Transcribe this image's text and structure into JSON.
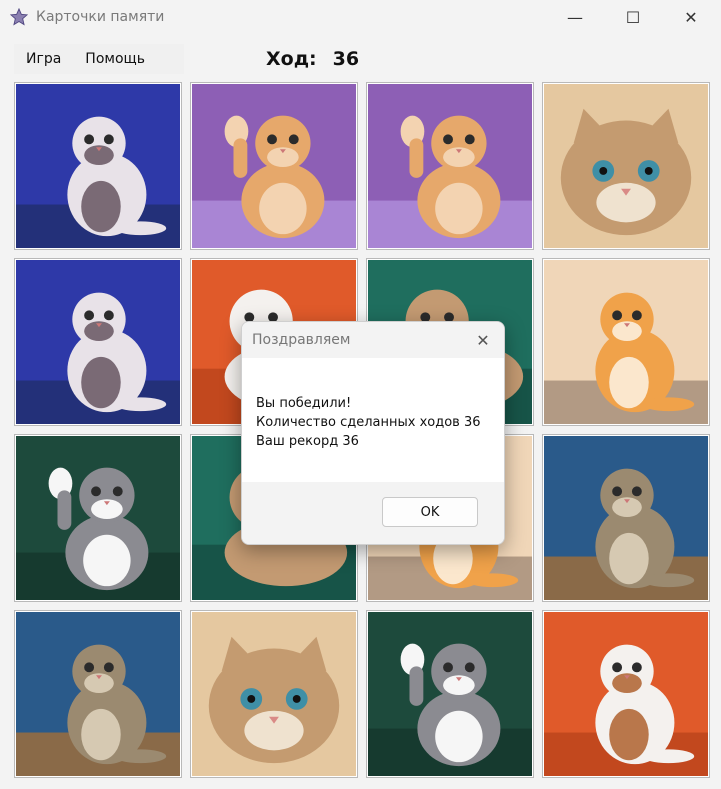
{
  "window": {
    "title": "Карточки памяти",
    "icon": "star-icon",
    "controls": {
      "minimize": "—",
      "maximize": "☐",
      "close": "✕"
    }
  },
  "menu": {
    "game": "Игра",
    "help": "Помощь"
  },
  "counter": {
    "label": "Ход:",
    "value": "36"
  },
  "cards": [
    {
      "bg": "#2e39a8",
      "floor": "#233079",
      "cat": "#e8e2e8",
      "patch": "#7a6a75",
      "pose": "sit"
    },
    {
      "bg": "#8d5fb5",
      "floor": "#a985d4",
      "cat": "#e6a86b",
      "patch": "#f3d3b1",
      "pose": "paw"
    },
    {
      "bg": "#8d5fb5",
      "floor": "#a985d4",
      "cat": "#e6a86b",
      "patch": "#f3d3b1",
      "pose": "paw"
    },
    {
      "bg": "#e5c8a0",
      "floor": "#d3b08a",
      "cat": "#c49b70",
      "patch": "#efe2cf",
      "pose": "face"
    },
    {
      "bg": "#2e39a8",
      "floor": "#233079",
      "cat": "#e8e2e8",
      "patch": "#7a6a75",
      "pose": "sit"
    },
    {
      "bg": "#e05a2a",
      "floor": "#c2481e",
      "cat": "#f4f1ee",
      "patch": "#b9774b",
      "pose": "lie"
    },
    {
      "bg": "#1f6e5e",
      "floor": "#175448",
      "cat": "#c39a72",
      "patch": "#f0e3d3",
      "pose": "lie"
    },
    {
      "bg": "#f0d6b8",
      "floor": "#b29a84",
      "cat": "#f0a24a",
      "patch": "#fbe7cd",
      "pose": "sit"
    },
    {
      "bg": "#1d4a3c",
      "floor": "#163a2f",
      "cat": "#8b8b91",
      "patch": "#f6f6f6",
      "pose": "paw"
    },
    {
      "bg": "#1f6e5e",
      "floor": "#175448",
      "cat": "#c39a72",
      "patch": "#f0e3d3",
      "pose": "lie"
    },
    {
      "bg": "#f0d6b8",
      "floor": "#b29a84",
      "cat": "#f0a24a",
      "patch": "#fbe7cd",
      "pose": "sit"
    },
    {
      "bg": "#2a5a8a",
      "floor": "#8a6a48",
      "cat": "#9b8a70",
      "patch": "#d6c9b2",
      "pose": "sit"
    },
    {
      "bg": "#2a5a8a",
      "floor": "#8a6a48",
      "cat": "#9b8a70",
      "patch": "#d6c9b2",
      "pose": "sit"
    },
    {
      "bg": "#e5c8a0",
      "floor": "#d3b08a",
      "cat": "#c49b70",
      "patch": "#efe2cf",
      "pose": "face"
    },
    {
      "bg": "#1d4a3c",
      "floor": "#163a2f",
      "cat": "#8b8b91",
      "patch": "#f6f6f6",
      "pose": "paw"
    },
    {
      "bg": "#e05a2a",
      "floor": "#c2481e",
      "cat": "#f4f1ee",
      "patch": "#b9774b",
      "pose": "sit"
    }
  ],
  "dialog": {
    "title": "Поздравляем",
    "line1": "Вы победили!",
    "line2": "Количество сделанных ходов 36",
    "line3": "Ваш рекорд 36",
    "ok": "OK"
  }
}
